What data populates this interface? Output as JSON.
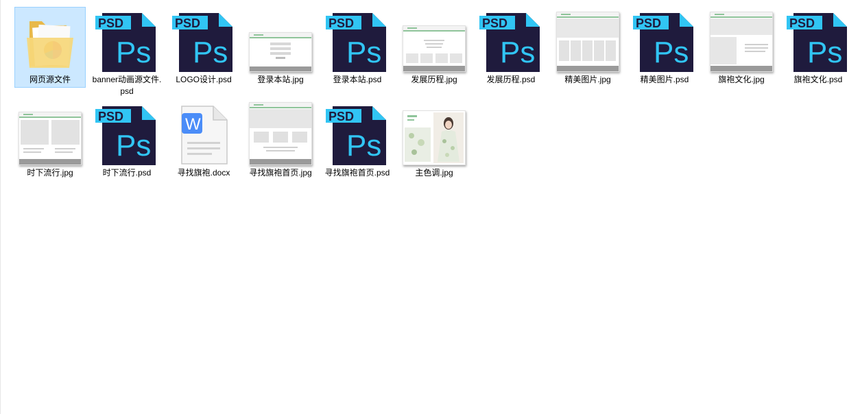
{
  "explorer": {
    "colors": {
      "selection_bg": "#cce8ff",
      "selection_border": "#99d1ff",
      "psd_dark": "#1f1b3d",
      "psd_cyan": "#31c5f4",
      "word_blue": "#4b8df8",
      "thumb_green": "#8fc49a"
    },
    "files": [
      {
        "label": "网页源文件",
        "type": "folder"
      },
      {
        "label": "banner动画源文件.psd",
        "type": "psd",
        "icon_text_top": "PSD",
        "icon_text_main": "Ps"
      },
      {
        "label": "LOGO设计.psd",
        "type": "psd",
        "icon_text_top": "PSD",
        "icon_text_main": "Ps"
      },
      {
        "label": "登录本站.jpg",
        "type": "jpg-login"
      },
      {
        "label": "登录本站.psd",
        "type": "psd",
        "icon_text_top": "PSD",
        "icon_text_main": "Ps"
      },
      {
        "label": "发展历程.jpg",
        "type": "jpg-history"
      },
      {
        "label": "发展历程.psd",
        "type": "psd",
        "icon_text_top": "PSD",
        "icon_text_main": "Ps"
      },
      {
        "label": "精美图片.jpg",
        "type": "jpg-gallery"
      },
      {
        "label": "精美图片.psd",
        "type": "psd",
        "icon_text_top": "PSD",
        "icon_text_main": "Ps"
      },
      {
        "label": "旗袍文化.jpg",
        "type": "jpg-culture"
      },
      {
        "label": "旗袍文化.psd",
        "type": "psd",
        "icon_text_top": "PSD",
        "icon_text_main": "Ps"
      },
      {
        "label": "时下流行.jpg",
        "type": "jpg-trend"
      },
      {
        "label": "时下流行.psd",
        "type": "psd",
        "icon_text_top": "PSD",
        "icon_text_main": "Ps"
      },
      {
        "label": "寻找旗袍.docx",
        "type": "docx",
        "icon_text_main": "W"
      },
      {
        "label": "寻找旗袍首页.jpg",
        "type": "jpg-home"
      },
      {
        "label": "寻找旗袍首页.psd",
        "type": "psd",
        "icon_text_top": "PSD",
        "icon_text_main": "Ps"
      },
      {
        "label": "主色调.jpg",
        "type": "jpg-color"
      }
    ]
  }
}
